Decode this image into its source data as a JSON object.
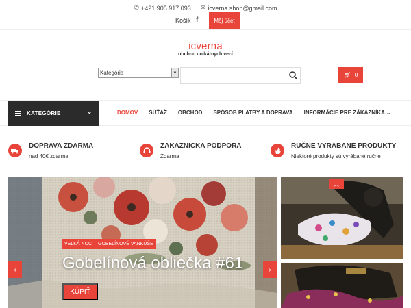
{
  "topbar": {
    "phone": "+421 905 917 093",
    "email": "icverna.shop@gmail.com",
    "cart_link": "Košík",
    "facebook": "f",
    "account_button": "Môj účet"
  },
  "logo": {
    "title": "icverna",
    "subtitle": "obchod unikátnych vecí"
  },
  "search": {
    "category_selected": "Kategória",
    "placeholder": "",
    "cart_count": "0"
  },
  "nav": {
    "categories_label": "KATEGÓRIE",
    "items": [
      {
        "label": "DOMOV"
      },
      {
        "label": "SÚŤAŽ"
      },
      {
        "label": "OBCHOD"
      },
      {
        "label": "SPÔSOB PLATBY A DOPRAVA"
      },
      {
        "label": "INFORMÁCIE PRE ZÁKAZNÍKA"
      }
    ]
  },
  "features": [
    {
      "title": "DOPRAVA ZDARMA",
      "subtitle": "nad 40€ zdarma",
      "icon": "truck-icon"
    },
    {
      "title": "ZAKAZNICKA PODPORA",
      "subtitle": "Zdarma",
      "icon": "headset-icon"
    },
    {
      "title": "RUČNE VYRÁBANÉ PRODUKTY",
      "subtitle": "Niektoré produkty sú vyrábané ručne",
      "icon": "hand-icon"
    }
  ],
  "slider": {
    "tags": [
      "VEĽKÁ NOC",
      "GOBELÍNOVÉ VANKÚŠE"
    ],
    "title": "Gobelínová obliečka #61",
    "button": "KÚPIŤ"
  },
  "colors": {
    "accent": "#e8443a",
    "dark": "#2b2b2b"
  }
}
